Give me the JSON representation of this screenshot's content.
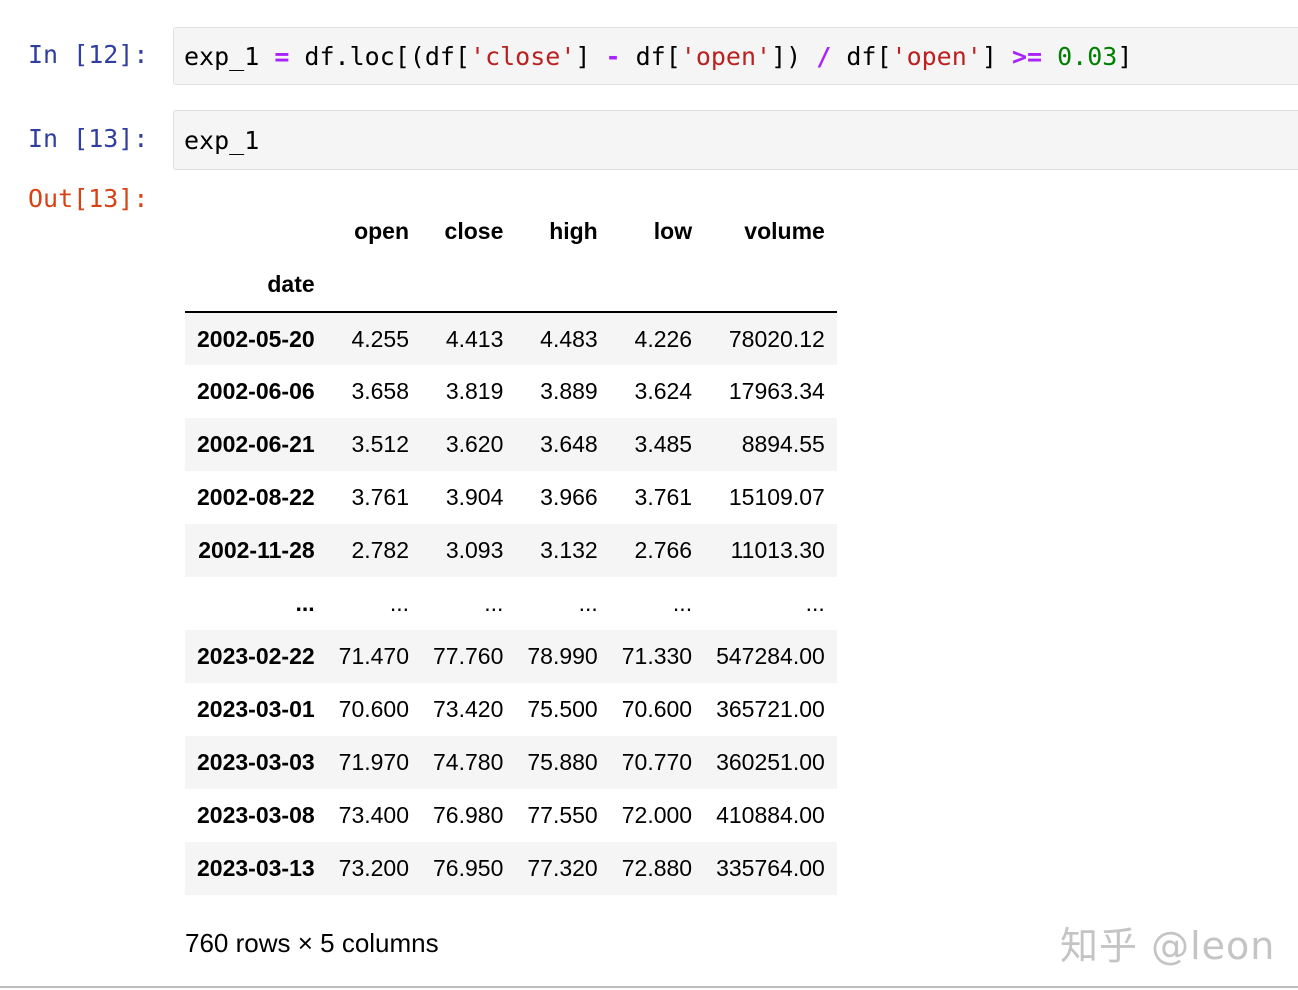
{
  "cells": [
    {
      "prompt": "In [12]:",
      "code": [
        {
          "t": "exp_1 ",
          "k": "var"
        },
        {
          "t": "=",
          "k": "op"
        },
        {
          "t": " df",
          "k": "var"
        },
        {
          "t": ".",
          "k": "punc"
        },
        {
          "t": "loc[(df[",
          "k": "var"
        },
        {
          "t": "'close'",
          "k": "str"
        },
        {
          "t": "] ",
          "k": "punc"
        },
        {
          "t": "-",
          "k": "op"
        },
        {
          "t": " df[",
          "k": "var"
        },
        {
          "t": "'open'",
          "k": "str"
        },
        {
          "t": "]) ",
          "k": "punc"
        },
        {
          "t": "/",
          "k": "op"
        },
        {
          "t": " df[",
          "k": "var"
        },
        {
          "t": "'open'",
          "k": "str"
        },
        {
          "t": "] ",
          "k": "punc"
        },
        {
          "t": ">=",
          "k": "op"
        },
        {
          "t": " ",
          "k": "var"
        },
        {
          "t": "0.03",
          "k": "num"
        },
        {
          "t": "]",
          "k": "punc"
        }
      ]
    },
    {
      "prompt": "In [13]:",
      "code": [
        {
          "t": "exp_1",
          "k": "var"
        }
      ]
    }
  ],
  "output": {
    "prompt": "Out[13]:",
    "index_name": "date",
    "columns": [
      "open",
      "close",
      "high",
      "low",
      "volume"
    ],
    "rows": [
      [
        "2002-05-20",
        "4.255",
        "4.413",
        "4.483",
        "4.226",
        "78020.12"
      ],
      [
        "2002-06-06",
        "3.658",
        "3.819",
        "3.889",
        "3.624",
        "17963.34"
      ],
      [
        "2002-06-21",
        "3.512",
        "3.620",
        "3.648",
        "3.485",
        "8894.55"
      ],
      [
        "2002-08-22",
        "3.761",
        "3.904",
        "3.966",
        "3.761",
        "15109.07"
      ],
      [
        "2002-11-28",
        "2.782",
        "3.093",
        "3.132",
        "2.766",
        "11013.30"
      ],
      [
        "...",
        "...",
        "...",
        "...",
        "...",
        "..."
      ],
      [
        "2023-02-22",
        "71.470",
        "77.760",
        "78.990",
        "71.330",
        "547284.00"
      ],
      [
        "2023-03-01",
        "70.600",
        "73.420",
        "75.500",
        "70.600",
        "365721.00"
      ],
      [
        "2023-03-03",
        "71.970",
        "74.780",
        "75.880",
        "70.770",
        "360251.00"
      ],
      [
        "2023-03-08",
        "73.400",
        "76.980",
        "77.550",
        "72.000",
        "410884.00"
      ],
      [
        "2023-03-13",
        "73.200",
        "76.950",
        "77.320",
        "72.880",
        "335764.00"
      ]
    ],
    "shape_text": "760 rows × 5 columns"
  },
  "watermark": "知乎 @leon"
}
